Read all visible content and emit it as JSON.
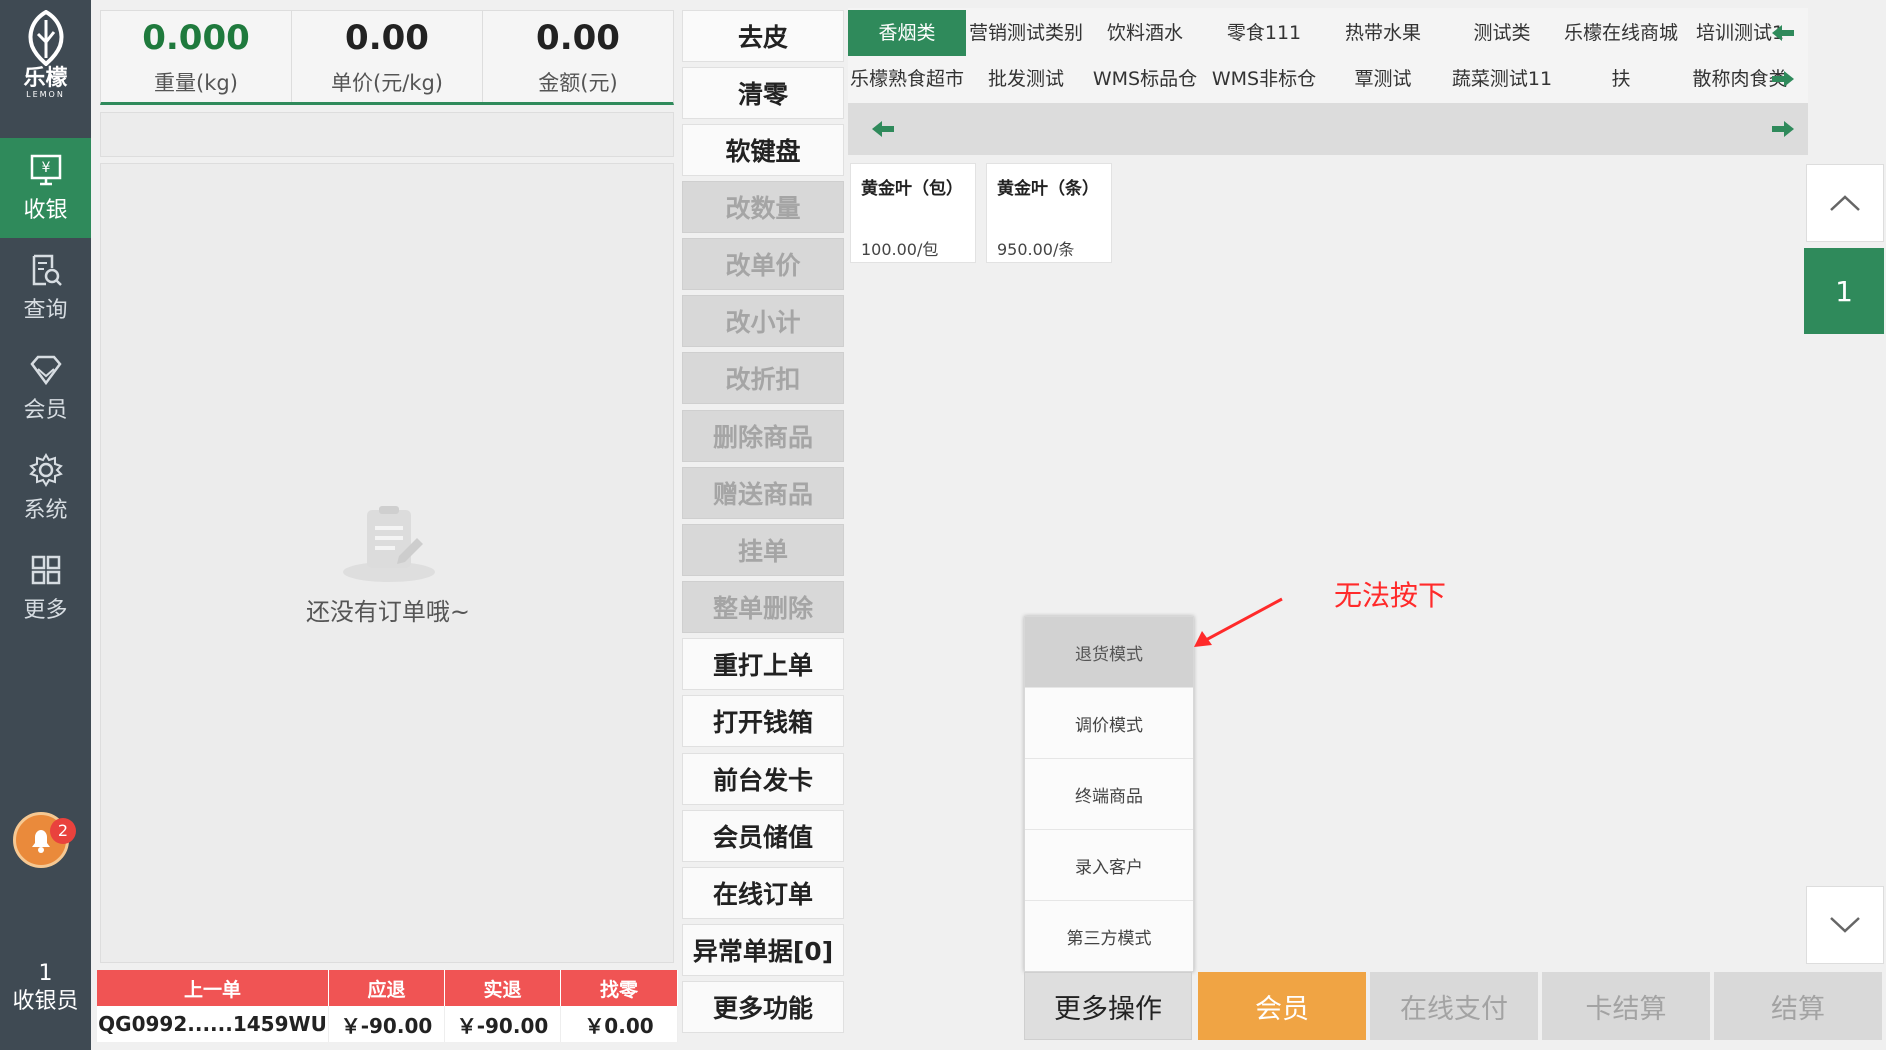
{
  "sidebar": {
    "logo_text": "乐檬",
    "logo_sub": "LEMON",
    "items": [
      {
        "label": "收银",
        "icon": "cashier-icon",
        "active": true
      },
      {
        "label": "查询",
        "icon": "search-doc-icon",
        "active": false
      },
      {
        "label": "会员",
        "icon": "diamond-icon",
        "active": false
      },
      {
        "label": "系统",
        "icon": "gear-icon",
        "active": false
      },
      {
        "label": "更多",
        "icon": "grid-icon",
        "active": false
      }
    ],
    "notification_count": "2",
    "cashier_id": "1",
    "cashier_label": "收银员"
  },
  "scale": {
    "weight_value": "0.000",
    "weight_label": "重量(kg)",
    "unit_price_value": "0.00",
    "unit_price_label": "单价(元/kg)",
    "amount_value": "0.00",
    "amount_label": "金额(元)"
  },
  "order": {
    "empty_text": "还没有订单哦~"
  },
  "last_order": {
    "headers": [
      "上一单",
      "应退",
      "实退",
      "找零"
    ],
    "values": [
      "QG0992......1459WU",
      "￥-90.00",
      "￥-90.00",
      "￥0.00"
    ]
  },
  "functions": [
    {
      "label": "去皮",
      "enabled": true
    },
    {
      "label": "清零",
      "enabled": true
    },
    {
      "label": "软键盘",
      "enabled": true
    },
    {
      "label": "改数量",
      "enabled": false
    },
    {
      "label": "改单价",
      "enabled": false
    },
    {
      "label": "改小计",
      "enabled": false
    },
    {
      "label": "改折扣",
      "enabled": false
    },
    {
      "label": "删除商品",
      "enabled": false
    },
    {
      "label": "赠送商品",
      "enabled": false
    },
    {
      "label": "挂单",
      "enabled": false
    },
    {
      "label": "整单删除",
      "enabled": false
    },
    {
      "label": "重打上单",
      "enabled": true
    },
    {
      "label": "打开钱箱",
      "enabled": true
    },
    {
      "label": "前台发卡",
      "enabled": true
    },
    {
      "label": "会员储值",
      "enabled": true
    },
    {
      "label": "在线订单",
      "enabled": true
    },
    {
      "label": "异常单据[0]",
      "enabled": true
    },
    {
      "label": "更多功能",
      "enabled": true
    }
  ],
  "categories": {
    "row1": [
      "香烟类",
      "营销测试类别",
      "饮料酒水",
      "零食111",
      "热带水果",
      "测试类",
      "乐檬在线商城",
      "培训测试1"
    ],
    "row2": [
      "乐檬熟食超市",
      "批发测试",
      "WMS标品仓",
      "WMS非标仓",
      "覃测试",
      "蔬菜测试11",
      "扶",
      "散称肉食类"
    ],
    "active": "香烟类"
  },
  "products": [
    {
      "name": "黄金叶（包）",
      "price": "100.00/包"
    },
    {
      "name": "黄金叶（条）",
      "price": "950.00/条"
    }
  ],
  "pager": {
    "current_page": "1"
  },
  "more_menu": {
    "items": [
      {
        "label": "退货模式",
        "enabled": false
      },
      {
        "label": "调价模式",
        "enabled": true
      },
      {
        "label": "终端商品",
        "enabled": true
      },
      {
        "label": "录入客户",
        "enabled": true
      },
      {
        "label": "第三方模式",
        "enabled": true
      }
    ]
  },
  "annotation": {
    "text": "无法按下"
  },
  "actions": {
    "more_ops": "更多操作",
    "member": "会员",
    "online_pay": "在线支付",
    "card_settle": "卡结算",
    "settle": "结算"
  },
  "colors": {
    "sidebar_bg": "#3f4a53",
    "brand_green": "#2f8a5b",
    "member_orange": "#f0a444",
    "header_red": "#f05454",
    "annotation_red": "#ff2a2a"
  }
}
